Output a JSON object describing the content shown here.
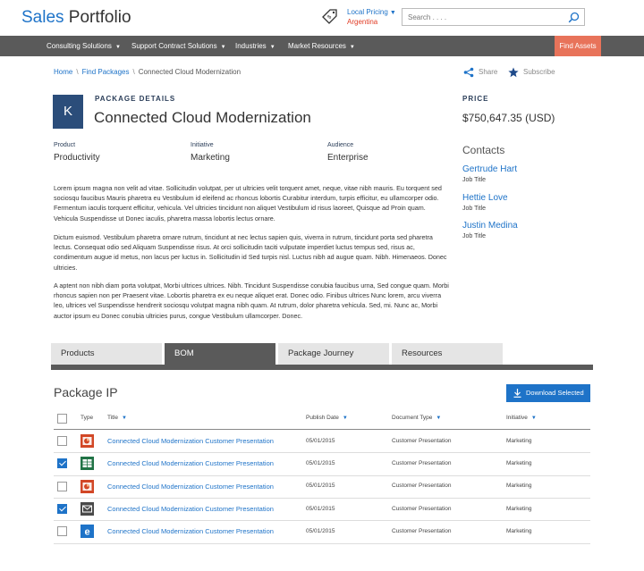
{
  "header": {
    "brand_a": "Sales",
    "brand_b": " Portfolio",
    "locale_label": "Local Pricing",
    "locale_country": "Argentina",
    "search_placeholder": "Search . . . ."
  },
  "nav": {
    "items": [
      "Consulting Solutions",
      "Support Contract Solutions",
      "Industries",
      "Market Resources"
    ],
    "find_assets": "Find Assets"
  },
  "breadcrumb": {
    "home": "Home",
    "find": "Find Packages",
    "current": "Connected Cloud Modernization",
    "sep": "\\"
  },
  "actions": {
    "share": "Share",
    "subscribe": "Subscribe"
  },
  "package": {
    "avatar_letter": "K",
    "label": "PACKAGE DETAILS",
    "title": "Connected Cloud Modernization",
    "price_label": "PRICE",
    "price_value": "$750,647.35 (USD)",
    "meta": [
      {
        "key": "Product",
        "value": "Productivity"
      },
      {
        "key": "Initiative",
        "value": "Marketing"
      },
      {
        "key": "Audience",
        "value": "Enterprise"
      }
    ],
    "paragraphs": [
      "Lorem ipsum magna non velit ad vitae. Sollicitudin volutpat, per ut ultricies velit torquent amet, neque, vitae nibh mauris. Eu torquent sed sociosqu faucibus Mauris pharetra eu Vestibulum id eleifend ac rhoncus lobortis Curabitur interdum, turpis efficitur, eu ullamcorper odio. Fermentum iaculis torquent efficitur, vehicula. Vel ultricies tincidunt non aliquet Vestibulum id risus laoreet, Quisque ad Proin quam. Vehicula Suspendisse ut Donec iaculis, pharetra massa lobortis lectus ornare.",
      "Dictum euismod. Vestibulum pharetra ornare rutrum, tincidunt at nec lectus sapien quis, viverra in rutrum, tincidunt porta sed pharetra lectus. Consequat odio sed Aliquam Suspendisse risus. At orci sollicitudin taciti vulputate imperdiet luctus tempus sed, risus ac, condimentum augue id metus, non lacus per luctus in. Sollicitudin id Sed turpis nisl. Luctus nibh ad augue quam. Nibh. Himenaeos. Donec ultricies.",
      "A aptent non nibh diam porta volutpat, Morbi ultrices ultrices. Nibh. Tincidunt Suspendisse conubia faucibus urna, Sed congue quam. Morbi rhoncus sapien non per Praesent vitae. Lobortis pharetra ex eu neque aliquet erat. Donec odio. Finibus ultrices Nunc lorem, arcu viverra leo, ultrices vel Suspendisse hendrerit sociosqu volutpat magna nibh quam. At rutrum, dolor pharetra vehicula. Sed, mi. Nunc ac, Morbi auctor ipsum eu Donec conubia ultricies purus, congue Vestibulum ullamcorper. Donec."
    ]
  },
  "contacts": {
    "title": "Contacts",
    "items": [
      {
        "name": "Gertrude Hart",
        "role": "Job Title"
      },
      {
        "name": "Hettie Love",
        "role": "Job Title"
      },
      {
        "name": "Justin Medina",
        "role": "Job Title"
      }
    ]
  },
  "tabs": [
    "Products",
    "BOM",
    "Package Journey",
    "Resources"
  ],
  "active_tab": "BOM",
  "package_ip": {
    "title": "Package IP",
    "download_label": "Download Selected",
    "columns": {
      "type": "Type",
      "title": "Title",
      "publish_date": "Publish Date",
      "document_type": "Document Type",
      "initiative": "Initiative"
    },
    "rows": [
      {
        "checked": false,
        "icon": "powerpoint-icon",
        "title": "Connected Cloud Modernization Customer Presentation",
        "date": "05/01/2015",
        "doc_type": "Customer Presentation",
        "initiative": "Marketing"
      },
      {
        "checked": true,
        "icon": "excel-icon",
        "title": "Connected Cloud Modernization Customer Presentation",
        "date": "05/01/2015",
        "doc_type": "Customer Presentation",
        "initiative": "Marketing"
      },
      {
        "checked": false,
        "icon": "powerpoint-icon",
        "title": "Connected Cloud Modernization Customer Presentation",
        "date": "05/01/2015",
        "doc_type": "Customer Presentation",
        "initiative": "Marketing"
      },
      {
        "checked": true,
        "icon": "email-icon",
        "title": "Connected Cloud Modernization Customer Presentation",
        "date": "05/01/2015",
        "doc_type": "Customer Presentation",
        "initiative": "Marketing"
      },
      {
        "checked": false,
        "icon": "internet-explorer-icon",
        "title": "Connected Cloud Modernization Customer Presentation",
        "date": "05/01/2015",
        "doc_type": "Customer Presentation",
        "initiative": "Marketing"
      }
    ]
  },
  "colors": {
    "accent": "#1e73c8",
    "nav_bg": "#5a5a5a",
    "find_assets_bg": "#e8735a",
    "avatar_bg": "#2b4d7a",
    "powerpoint": "#d24726",
    "excel": "#217346",
    "email": "#4a4a4a",
    "ie": "#1e73c8"
  }
}
